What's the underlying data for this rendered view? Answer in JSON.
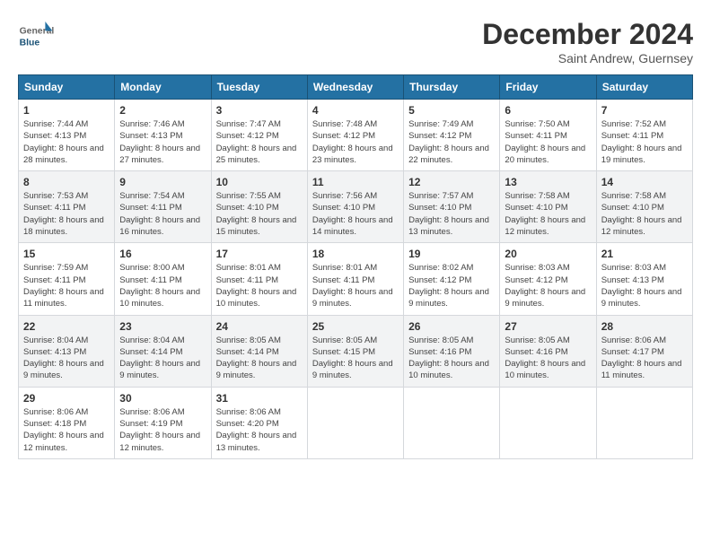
{
  "header": {
    "logo_general": "General",
    "logo_blue": "Blue",
    "month_title": "December 2024",
    "subtitle": "Saint Andrew, Guernsey"
  },
  "days_of_week": [
    "Sunday",
    "Monday",
    "Tuesday",
    "Wednesday",
    "Thursday",
    "Friday",
    "Saturday"
  ],
  "weeks": [
    [
      {
        "day": "1",
        "sunrise": "Sunrise: 7:44 AM",
        "sunset": "Sunset: 4:13 PM",
        "daylight": "Daylight: 8 hours and 28 minutes."
      },
      {
        "day": "2",
        "sunrise": "Sunrise: 7:46 AM",
        "sunset": "Sunset: 4:13 PM",
        "daylight": "Daylight: 8 hours and 27 minutes."
      },
      {
        "day": "3",
        "sunrise": "Sunrise: 7:47 AM",
        "sunset": "Sunset: 4:12 PM",
        "daylight": "Daylight: 8 hours and 25 minutes."
      },
      {
        "day": "4",
        "sunrise": "Sunrise: 7:48 AM",
        "sunset": "Sunset: 4:12 PM",
        "daylight": "Daylight: 8 hours and 23 minutes."
      },
      {
        "day": "5",
        "sunrise": "Sunrise: 7:49 AM",
        "sunset": "Sunset: 4:12 PM",
        "daylight": "Daylight: 8 hours and 22 minutes."
      },
      {
        "day": "6",
        "sunrise": "Sunrise: 7:50 AM",
        "sunset": "Sunset: 4:11 PM",
        "daylight": "Daylight: 8 hours and 20 minutes."
      },
      {
        "day": "7",
        "sunrise": "Sunrise: 7:52 AM",
        "sunset": "Sunset: 4:11 PM",
        "daylight": "Daylight: 8 hours and 19 minutes."
      }
    ],
    [
      {
        "day": "8",
        "sunrise": "Sunrise: 7:53 AM",
        "sunset": "Sunset: 4:11 PM",
        "daylight": "Daylight: 8 hours and 18 minutes."
      },
      {
        "day": "9",
        "sunrise": "Sunrise: 7:54 AM",
        "sunset": "Sunset: 4:11 PM",
        "daylight": "Daylight: 8 hours and 16 minutes."
      },
      {
        "day": "10",
        "sunrise": "Sunrise: 7:55 AM",
        "sunset": "Sunset: 4:10 PM",
        "daylight": "Daylight: 8 hours and 15 minutes."
      },
      {
        "day": "11",
        "sunrise": "Sunrise: 7:56 AM",
        "sunset": "Sunset: 4:10 PM",
        "daylight": "Daylight: 8 hours and 14 minutes."
      },
      {
        "day": "12",
        "sunrise": "Sunrise: 7:57 AM",
        "sunset": "Sunset: 4:10 PM",
        "daylight": "Daylight: 8 hours and 13 minutes."
      },
      {
        "day": "13",
        "sunrise": "Sunrise: 7:58 AM",
        "sunset": "Sunset: 4:10 PM",
        "daylight": "Daylight: 8 hours and 12 minutes."
      },
      {
        "day": "14",
        "sunrise": "Sunrise: 7:58 AM",
        "sunset": "Sunset: 4:10 PM",
        "daylight": "Daylight: 8 hours and 12 minutes."
      }
    ],
    [
      {
        "day": "15",
        "sunrise": "Sunrise: 7:59 AM",
        "sunset": "Sunset: 4:11 PM",
        "daylight": "Daylight: 8 hours and 11 minutes."
      },
      {
        "day": "16",
        "sunrise": "Sunrise: 8:00 AM",
        "sunset": "Sunset: 4:11 PM",
        "daylight": "Daylight: 8 hours and 10 minutes."
      },
      {
        "day": "17",
        "sunrise": "Sunrise: 8:01 AM",
        "sunset": "Sunset: 4:11 PM",
        "daylight": "Daylight: 8 hours and 10 minutes."
      },
      {
        "day": "18",
        "sunrise": "Sunrise: 8:01 AM",
        "sunset": "Sunset: 4:11 PM",
        "daylight": "Daylight: 8 hours and 9 minutes."
      },
      {
        "day": "19",
        "sunrise": "Sunrise: 8:02 AM",
        "sunset": "Sunset: 4:12 PM",
        "daylight": "Daylight: 8 hours and 9 minutes."
      },
      {
        "day": "20",
        "sunrise": "Sunrise: 8:03 AM",
        "sunset": "Sunset: 4:12 PM",
        "daylight": "Daylight: 8 hours and 9 minutes."
      },
      {
        "day": "21",
        "sunrise": "Sunrise: 8:03 AM",
        "sunset": "Sunset: 4:13 PM",
        "daylight": "Daylight: 8 hours and 9 minutes."
      }
    ],
    [
      {
        "day": "22",
        "sunrise": "Sunrise: 8:04 AM",
        "sunset": "Sunset: 4:13 PM",
        "daylight": "Daylight: 8 hours and 9 minutes."
      },
      {
        "day": "23",
        "sunrise": "Sunrise: 8:04 AM",
        "sunset": "Sunset: 4:14 PM",
        "daylight": "Daylight: 8 hours and 9 minutes."
      },
      {
        "day": "24",
        "sunrise": "Sunrise: 8:05 AM",
        "sunset": "Sunset: 4:14 PM",
        "daylight": "Daylight: 8 hours and 9 minutes."
      },
      {
        "day": "25",
        "sunrise": "Sunrise: 8:05 AM",
        "sunset": "Sunset: 4:15 PM",
        "daylight": "Daylight: 8 hours and 9 minutes."
      },
      {
        "day": "26",
        "sunrise": "Sunrise: 8:05 AM",
        "sunset": "Sunset: 4:16 PM",
        "daylight": "Daylight: 8 hours and 10 minutes."
      },
      {
        "day": "27",
        "sunrise": "Sunrise: 8:05 AM",
        "sunset": "Sunset: 4:16 PM",
        "daylight": "Daylight: 8 hours and 10 minutes."
      },
      {
        "day": "28",
        "sunrise": "Sunrise: 8:06 AM",
        "sunset": "Sunset: 4:17 PM",
        "daylight": "Daylight: 8 hours and 11 minutes."
      }
    ],
    [
      {
        "day": "29",
        "sunrise": "Sunrise: 8:06 AM",
        "sunset": "Sunset: 4:18 PM",
        "daylight": "Daylight: 8 hours and 12 minutes."
      },
      {
        "day": "30",
        "sunrise": "Sunrise: 8:06 AM",
        "sunset": "Sunset: 4:19 PM",
        "daylight": "Daylight: 8 hours and 12 minutes."
      },
      {
        "day": "31",
        "sunrise": "Sunrise: 8:06 AM",
        "sunset": "Sunset: 4:20 PM",
        "daylight": "Daylight: 8 hours and 13 minutes."
      },
      null,
      null,
      null,
      null
    ]
  ]
}
